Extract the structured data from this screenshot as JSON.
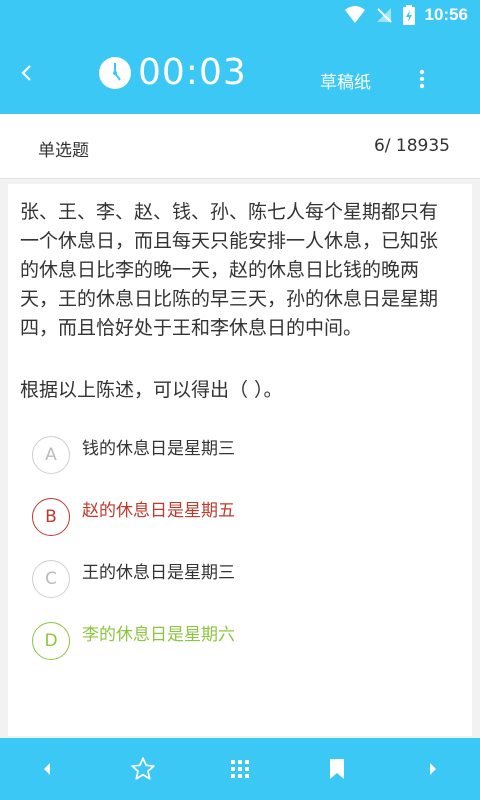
{
  "status_bar": {
    "time": "10:56"
  },
  "app_bar": {
    "timer": "00:03",
    "draft_label": "草稿纸"
  },
  "sub_header": {
    "question_type": "单选题",
    "progress": "6/ 18935"
  },
  "question": {
    "stem": "张、王、李、赵、钱、孙、陈七人每个星期都只有一个休息日，而且每天只能安排一人休息，已知张的休息日比李的晚一天，赵的休息日比钱的晚两天，王的休息日比陈的早三天，孙的休息日是星期四，而且恰好处于王和李休息日的中间。",
    "ask": "根据以上陈述，可以得出（ ）。",
    "options": [
      {
        "letter": "A",
        "text": "钱的休息日是星期三",
        "state": "normal"
      },
      {
        "letter": "B",
        "text": "赵的休息日是星期五",
        "state": "wrong"
      },
      {
        "letter": "C",
        "text": "王的休息日是星期三",
        "state": "normal"
      },
      {
        "letter": "D",
        "text": "李的休息日是星期六",
        "state": "right"
      }
    ]
  },
  "colors": {
    "accent": "#3cc8f5",
    "wrong": "#c0392b",
    "right": "#8cc63f"
  },
  "icons": {
    "bottom_bar": [
      "prev-icon",
      "star-icon",
      "grid-icon",
      "bookmark-icon",
      "next-icon"
    ]
  }
}
